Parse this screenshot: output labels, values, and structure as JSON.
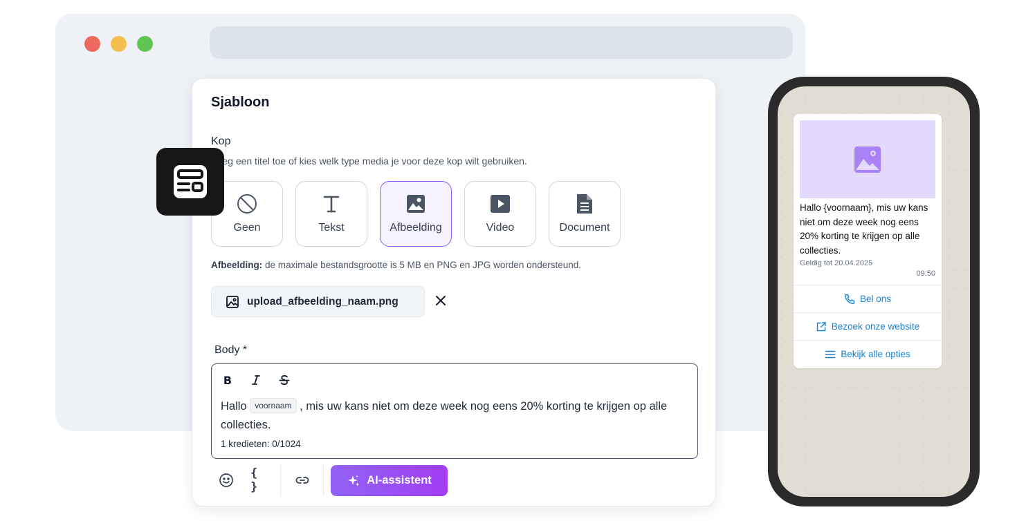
{
  "template": {
    "title": "Sjabloon",
    "header": {
      "label": "Kop",
      "description": "Voeg een titel toe of kies welk type media je voor deze kop wilt gebruiken.",
      "options": [
        {
          "label": "Geen",
          "icon": "no-media-icon"
        },
        {
          "label": "Tekst",
          "icon": "text-icon"
        },
        {
          "label": "Afbeelding",
          "icon": "image-icon",
          "selected": true
        },
        {
          "label": "Video",
          "icon": "video-icon"
        },
        {
          "label": "Document",
          "icon": "document-icon"
        }
      ],
      "info_bold": "Afbeelding:",
      "info_text": " de maximale bestandsgrootte is 5 MB en PNG en JPG worden ondersteund.",
      "file_name": "upload_afbeelding_naam.png"
    },
    "body": {
      "label": "Body *",
      "text_before": "Hallo ",
      "variable": "voornaam",
      "text_after": " , mis uw kans niet om deze week nog eens 20% korting te krijgen op alle collecties.",
      "credits": "1 kredieten: 0/1024"
    },
    "toolbar": {
      "braces": "{ }",
      "ai_label": "AI-assistent"
    }
  },
  "preview": {
    "message": "Hallo {voornaam}, mis uw kans niet om deze week nog eens 20% korting te krijgen op alle collecties.",
    "valid_until": "Geldig tot 20.04.2025",
    "time": "09:50",
    "actions": [
      {
        "label": "Bel ons",
        "icon": "phone-icon"
      },
      {
        "label": "Bezoek onze website",
        "icon": "external-link-icon"
      },
      {
        "label": "Bekijk alle opties",
        "icon": "list-icon"
      }
    ]
  },
  "colors": {
    "accent": "#8b5cf6",
    "link": "#1a83d4",
    "ai_gradient_start": "#9063f5",
    "ai_gradient_end": "#a23df2"
  }
}
